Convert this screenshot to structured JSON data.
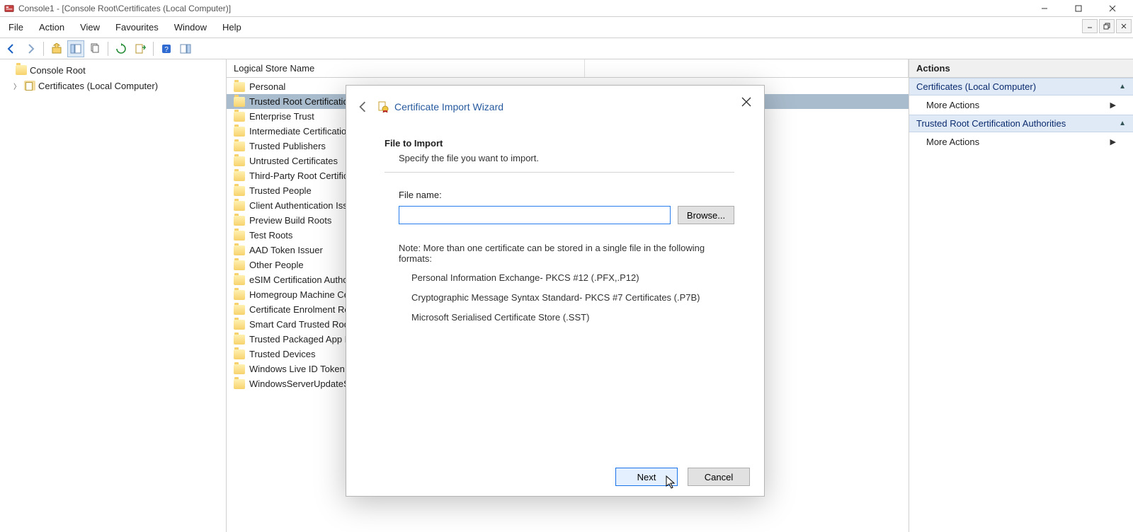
{
  "window": {
    "title": "Console1 - [Console Root\\Certificates (Local Computer)]"
  },
  "menu": {
    "items": [
      "File",
      "Action",
      "View",
      "Favourites",
      "Window",
      "Help"
    ]
  },
  "tree": {
    "root_label": "Console Root",
    "child_label": "Certificates (Local Computer)"
  },
  "list": {
    "header": "Logical Store Name",
    "items": [
      {
        "label": "Personal",
        "selected": false
      },
      {
        "label": "Trusted Root Certification Authorities",
        "selected": true
      },
      {
        "label": "Enterprise Trust",
        "selected": false
      },
      {
        "label": "Intermediate Certification Authorities",
        "selected": false
      },
      {
        "label": "Trusted Publishers",
        "selected": false
      },
      {
        "label": "Untrusted Certificates",
        "selected": false
      },
      {
        "label": "Third-Party Root Certification Authorities",
        "selected": false
      },
      {
        "label": "Trusted People",
        "selected": false
      },
      {
        "label": "Client Authentication Issuers",
        "selected": false
      },
      {
        "label": "Preview Build Roots",
        "selected": false
      },
      {
        "label": "Test Roots",
        "selected": false
      },
      {
        "label": "AAD Token Issuer",
        "selected": false
      },
      {
        "label": "Other People",
        "selected": false
      },
      {
        "label": "eSIM Certification Authorities",
        "selected": false
      },
      {
        "label": "Homegroup Machine Certificates",
        "selected": false
      },
      {
        "label": "Certificate Enrolment Requests",
        "selected": false
      },
      {
        "label": "Smart Card Trusted Roots",
        "selected": false
      },
      {
        "label": "Trusted Packaged App Installation Authorities",
        "selected": false
      },
      {
        "label": "Trusted Devices",
        "selected": false
      },
      {
        "label": "Windows Live ID Token Issuer",
        "selected": false
      },
      {
        "label": "WindowsServerUpdateServices",
        "selected": false
      }
    ]
  },
  "actions": {
    "title": "Actions",
    "section1": {
      "header": "Certificates (Local Computer)",
      "item": "More Actions"
    },
    "section2": {
      "header": "Trusted Root Certification Authorities",
      "item": "More Actions"
    }
  },
  "dialog": {
    "title": "Certificate Import Wizard",
    "heading": "File to Import",
    "subheading": "Specify the file you want to import.",
    "file_label": "File name:",
    "file_value": "",
    "browse_label": "Browse...",
    "note_prefix": "Note:  More than one certificate can be stored in a single file in the following formats:",
    "formats": [
      "Personal Information Exchange- PKCS #12 (.PFX,.P12)",
      "Cryptographic Message Syntax Standard- PKCS #7 Certificates (.P7B)",
      "Microsoft Serialised Certificate Store (.SST)"
    ],
    "next_label": "Next",
    "cancel_label": "Cancel"
  }
}
